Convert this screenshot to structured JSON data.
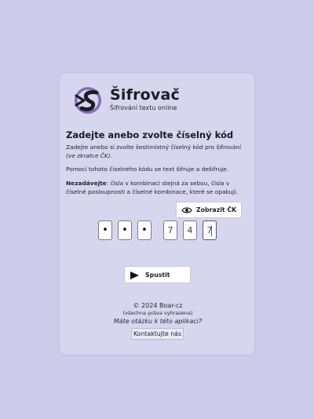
{
  "brand": {
    "name": "Šifrovač",
    "subtitle": "Šifrování textu online"
  },
  "heading": "Zadejte anebo zvolte číselný kód",
  "paragraph1": {
    "text": "Zadejte anebo si zvolte šestimístný číselný kód pro šifrování ",
    "note": "(ve zkratce ČK)",
    "end": "."
  },
  "paragraph2": "Pomocí tohoto číselného kódu se text šifruje a dešifruje.",
  "paragraph3": {
    "bold": "Nezadávejte",
    "text": ": čísla v kombinaci stejná za sebou, čísla v číselné posloupnosti a číselné kombinace, které se opakují."
  },
  "show_code_button": {
    "label": "Zobrazit ČK",
    "icon": "eye-icon"
  },
  "code_digits": [
    {
      "value": "•",
      "masked": true
    },
    {
      "value": "•",
      "masked": true
    },
    {
      "value": "•",
      "masked": true
    },
    {
      "value": "7",
      "masked": false
    },
    {
      "value": "4",
      "masked": false
    },
    {
      "value": "7",
      "masked": false,
      "active": true
    }
  ],
  "run_button": {
    "label": "Spustit",
    "icon": "play-icon"
  },
  "footer": {
    "copyright": "© 2024 Boar-cz",
    "rights": "(všechna práva vyhrazena)",
    "question": "Máte otázku k této aplikaci?",
    "contact_label": "Kontaktujte nás"
  },
  "colors": {
    "background": "#cdcbe9",
    "card": "#d7d6ef",
    "logo_circle": "#7d6bb0",
    "text": "#1e1e28"
  }
}
